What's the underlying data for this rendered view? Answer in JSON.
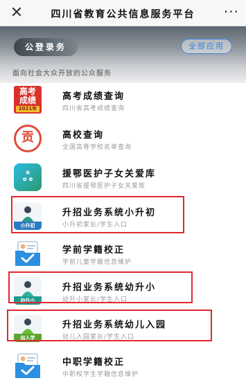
{
  "nav": {
    "close_glyph": "✕",
    "title": "四川省教育公共信息服务平台",
    "more_glyph": "···"
  },
  "hero": {
    "logo_text": "公登录务",
    "all_apps_label": "全部应用"
  },
  "subtitle": "面向社会大众开放的公众服务",
  "items": [
    {
      "name": "高考成绩查询",
      "desc": "四川省高考成绩查询",
      "icon": "gaokao-badge-icon",
      "icon_l1": "高考",
      "icon_l2": "成绩",
      "icon_year": "2021年"
    },
    {
      "name": "高校查询",
      "desc": "全国高等学校名单查询",
      "icon": "university-icon",
      "icon_glyph": "贡"
    },
    {
      "name": "援鄂医护子女关爱库",
      "desc": "四川省援鄂医护子女关爱库",
      "icon": "heart-care-icon",
      "icon_glyph": "ஃ"
    },
    {
      "name": "升招业务系统小升初",
      "desc": "小升初家长/学生入口",
      "icon": "student-icon",
      "tag": "小升初",
      "tag_color": "#2b7bc4",
      "highlighted": true
    },
    {
      "name": "学前学籍校正",
      "desc": "学前儿童学籍信息维护",
      "icon": "id-card-folder-icon",
      "highlighted": false
    },
    {
      "name": "升招业务系统幼升小",
      "desc": "幼升小家长/学生入口",
      "icon": "student-icon",
      "tag": "幼升小",
      "tag_color": "#1f9a8c",
      "highlighted": true
    },
    {
      "name": "升招业务系统幼儿入园",
      "desc": "幼儿入园家长/学生入口",
      "icon": "student-icon",
      "tag": "幼入学",
      "tag_color": "#5ca42f",
      "highlighted": true
    },
    {
      "name": "中职学籍校正",
      "desc": "中职校学生学籍信息维护",
      "icon": "id-card-folder-icon",
      "highlighted": false
    }
  ],
  "colors": {
    "highlight": "#e0282e",
    "accent_blue": "#3a82d9"
  }
}
